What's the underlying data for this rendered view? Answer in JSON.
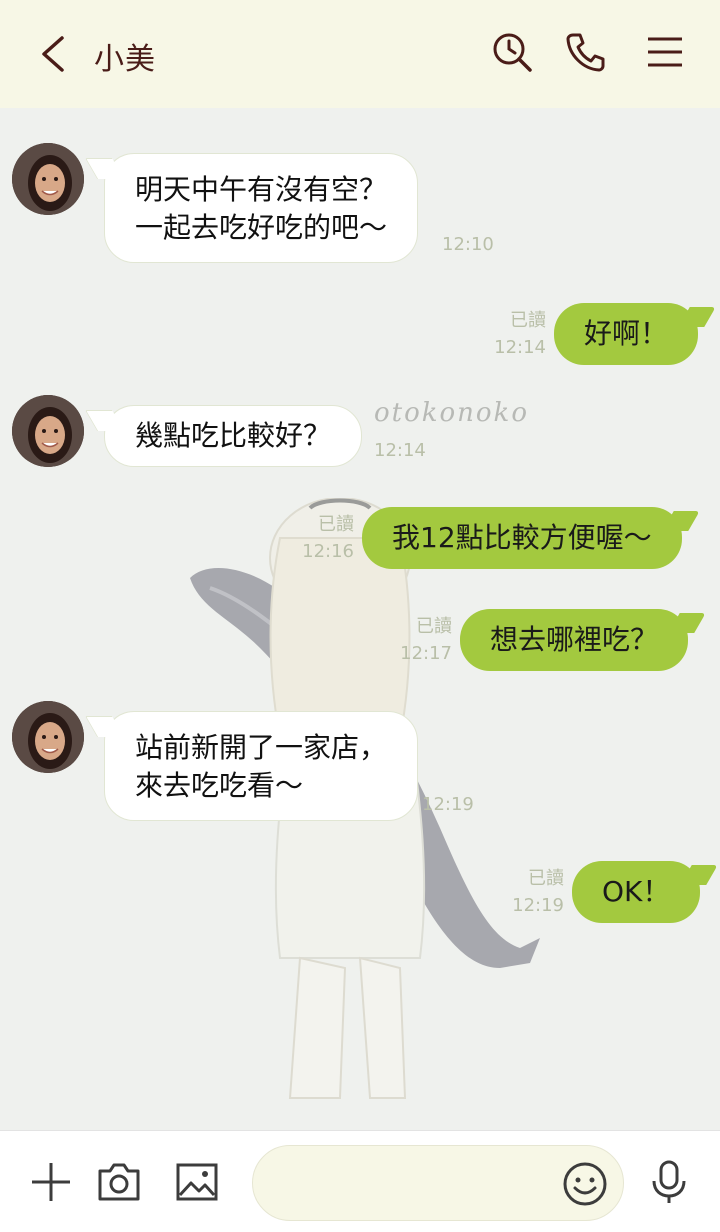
{
  "header": {
    "title": "小美",
    "icons": [
      "back-icon",
      "search-clock-icon",
      "phone-icon",
      "menu-icon"
    ]
  },
  "wallpaper": {
    "watermark": "otokonoko"
  },
  "messages": [
    {
      "side": "in",
      "lines": [
        "明天中午有沒有空？",
        "一起去吃好吃的吧～"
      ],
      "time": "12:10"
    },
    {
      "side": "out",
      "lines": [
        "好啊！"
      ],
      "read": "已讀",
      "time": "12:14"
    },
    {
      "side": "in",
      "lines": [
        "幾點吃比較好？"
      ],
      "time": "12:14"
    },
    {
      "side": "out",
      "lines": [
        "我12點比較方便喔～"
      ],
      "read": "已讀",
      "time": "12:16"
    },
    {
      "side": "out",
      "lines": [
        "想去哪裡吃？"
      ],
      "read": "已讀",
      "time": "12:17"
    },
    {
      "side": "in",
      "lines": [
        "站前新開了一家店，",
        "來去吃吃看～"
      ],
      "time": "12:19"
    },
    {
      "side": "out",
      "lines": [
        "OK！"
      ],
      "read": "已讀",
      "time": "12:19"
    }
  ],
  "footer": {
    "input_value": "",
    "icons": [
      "plus-icon",
      "camera-icon",
      "image-icon",
      "emoji-icon",
      "microphone-icon"
    ]
  },
  "colors": {
    "header_bg": "#f7f7e6",
    "chat_bg": "#eff1ee",
    "outgoing_bubble": "#a3c93f",
    "incoming_bubble": "#ffffff",
    "title_text": "#4a1c18",
    "meta_text": "#b9bfa8"
  }
}
